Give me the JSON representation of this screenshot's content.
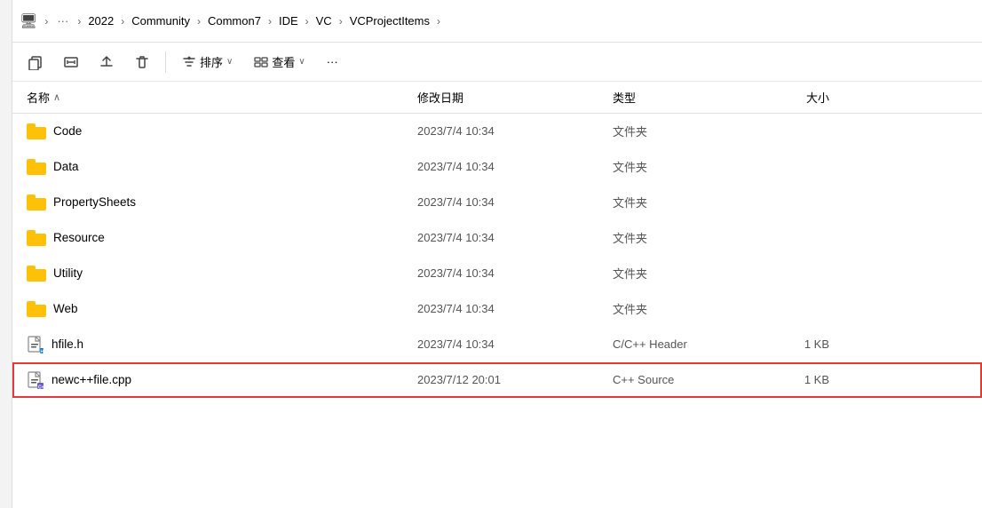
{
  "breadcrumb": {
    "items": [
      {
        "label": "💻",
        "type": "icon",
        "name": "monitor"
      },
      {
        "label": "›",
        "type": "sep"
      },
      {
        "label": "…",
        "type": "ellipsis"
      },
      {
        "label": "›",
        "type": "sep"
      },
      {
        "label": "2022",
        "type": "crumb"
      },
      {
        "label": "›",
        "type": "sep"
      },
      {
        "label": "Community",
        "type": "crumb"
      },
      {
        "label": "›",
        "type": "sep"
      },
      {
        "label": "Common7",
        "type": "crumb"
      },
      {
        "label": "›",
        "type": "sep"
      },
      {
        "label": "IDE",
        "type": "crumb"
      },
      {
        "label": "›",
        "type": "sep"
      },
      {
        "label": "VC",
        "type": "crumb"
      },
      {
        "label": "›",
        "type": "sep"
      },
      {
        "label": "VCProjectItems",
        "type": "crumb"
      },
      {
        "label": "›",
        "type": "sep"
      }
    ]
  },
  "toolbar": {
    "copy_label": "复制",
    "rename_label": "重命名",
    "share_label": "共享",
    "delete_label": "删除",
    "sort_label": "排序",
    "view_label": "查看",
    "more_label": "···"
  },
  "columns": {
    "name": "名称",
    "date": "修改日期",
    "type": "类型",
    "size": "大小"
  },
  "files": [
    {
      "name": "Code",
      "date": "2023/7/4 10:34",
      "type": "文件夹",
      "size": "",
      "icon": "folder"
    },
    {
      "name": "Data",
      "date": "2023/7/4 10:34",
      "type": "文件夹",
      "size": "",
      "icon": "folder"
    },
    {
      "name": "PropertySheets",
      "date": "2023/7/4 10:34",
      "type": "文件夹",
      "size": "",
      "icon": "folder"
    },
    {
      "name": "Resource",
      "date": "2023/7/4 10:34",
      "type": "文件夹",
      "size": "",
      "icon": "folder"
    },
    {
      "name": "Utility",
      "date": "2023/7/4 10:34",
      "type": "文件夹",
      "size": "",
      "icon": "folder"
    },
    {
      "name": "Web",
      "date": "2023/7/4 10:34",
      "type": "文件夹",
      "size": "",
      "icon": "folder"
    },
    {
      "name": "hfile.h",
      "date": "2023/7/4 10:34",
      "type": "C/C++ Header",
      "size": "1 KB",
      "icon": "header"
    },
    {
      "name": "newc++file.cpp",
      "date": "2023/7/12 20:01",
      "type": "C++ Source",
      "size": "1 KB",
      "icon": "cpp",
      "selected": true
    }
  ]
}
